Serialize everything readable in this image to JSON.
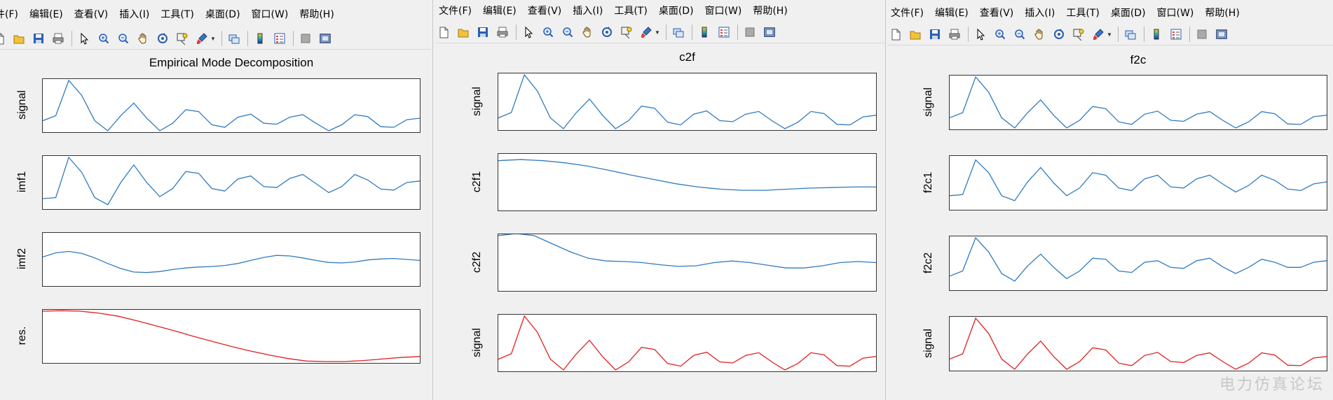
{
  "windows": [
    {
      "id": "left",
      "menu": [
        "件(F)",
        "编辑(E)",
        "查看(V)",
        "插入(I)",
        "工具(T)",
        "桌面(D)",
        "窗口(W)",
        "帮助(H)"
      ],
      "title": "Empirical Mode Decomposition",
      "subplots": [
        {
          "ylabel": "signal",
          "color": "#2f7bbf",
          "values": [
            0.2,
            0.3,
            1.0,
            0.7,
            0.2,
            0.0,
            0.3,
            0.55,
            0.25,
            0.0,
            0.15,
            0.42,
            0.38,
            0.12,
            0.07,
            0.27,
            0.33,
            0.15,
            0.13,
            0.27,
            0.32,
            0.15,
            0.0,
            0.12,
            0.32,
            0.28,
            0.08,
            0.07,
            0.22,
            0.25
          ]
        },
        {
          "ylabel": "imf1",
          "color": "#2f7bbf",
          "values": [
            0.18,
            0.2,
            1.0,
            0.7,
            0.2,
            0.06,
            0.5,
            0.85,
            0.5,
            0.22,
            0.38,
            0.72,
            0.68,
            0.38,
            0.33,
            0.57,
            0.63,
            0.42,
            0.4,
            0.58,
            0.66,
            0.48,
            0.3,
            0.42,
            0.66,
            0.55,
            0.37,
            0.35,
            0.5,
            0.53
          ]
        },
        {
          "ylabel": "imf2",
          "color": "#2f7bbf",
          "values": [
            0.55,
            0.63,
            0.66,
            0.62,
            0.53,
            0.42,
            0.32,
            0.25,
            0.24,
            0.26,
            0.3,
            0.33,
            0.35,
            0.36,
            0.38,
            0.42,
            0.48,
            0.54,
            0.58,
            0.57,
            0.53,
            0.48,
            0.44,
            0.43,
            0.45,
            0.49,
            0.51,
            0.52,
            0.5,
            0.48
          ]
        },
        {
          "ylabel": "res.",
          "color": "#e02020",
          "values": [
            1.0,
            1.01,
            1.0,
            0.96,
            0.9,
            0.81,
            0.71,
            0.61,
            0.5,
            0.4,
            0.3,
            0.21,
            0.13,
            0.06,
            0.01,
            0.0,
            0.0,
            0.02,
            0.05,
            0.08,
            0.1
          ]
        }
      ]
    },
    {
      "id": "mid",
      "menu": [
        "文件(F)",
        "编辑(E)",
        "查看(V)",
        "插入(I)",
        "工具(T)",
        "桌面(D)",
        "窗口(W)",
        "帮助(H)"
      ],
      "title": "c2f",
      "subplots": [
        {
          "ylabel": "signal",
          "color": "#2f7bbf",
          "values": [
            0.2,
            0.3,
            1.0,
            0.7,
            0.2,
            0.0,
            0.3,
            0.55,
            0.25,
            0.0,
            0.15,
            0.42,
            0.38,
            0.12,
            0.07,
            0.27,
            0.33,
            0.15,
            0.13,
            0.27,
            0.32,
            0.15,
            0.0,
            0.12,
            0.32,
            0.28,
            0.08,
            0.07,
            0.22,
            0.25
          ]
        },
        {
          "ylabel": "c2f1",
          "color": "#2f7bbf",
          "values": [
            0.9,
            0.92,
            0.9,
            0.86,
            0.8,
            0.72,
            0.63,
            0.55,
            0.47,
            0.41,
            0.37,
            0.35,
            0.35,
            0.37,
            0.39,
            0.4,
            0.41,
            0.41
          ]
        },
        {
          "ylabel": "c2f2",
          "color": "#2f7bbf",
          "values": [
            1.0,
            1.04,
            1.0,
            0.85,
            0.7,
            0.58,
            0.53,
            0.52,
            0.5,
            0.46,
            0.43,
            0.44,
            0.5,
            0.53,
            0.5,
            0.45,
            0.4,
            0.4,
            0.44,
            0.5,
            0.52,
            0.5
          ]
        },
        {
          "ylabel": "signal",
          "color": "#e02020",
          "values": [
            0.2,
            0.3,
            1.0,
            0.7,
            0.2,
            0.0,
            0.3,
            0.55,
            0.25,
            0.0,
            0.15,
            0.42,
            0.38,
            0.12,
            0.07,
            0.27,
            0.33,
            0.15,
            0.13,
            0.27,
            0.32,
            0.15,
            0.0,
            0.12,
            0.32,
            0.28,
            0.08,
            0.07,
            0.22,
            0.25
          ]
        }
      ]
    },
    {
      "id": "right",
      "menu": [
        "文件(F)",
        "编辑(E)",
        "查看(V)",
        "插入(I)",
        "工具(T)",
        "桌面(D)",
        "窗口(W)",
        "帮助(H)"
      ],
      "title": "f2c",
      "subplots": [
        {
          "ylabel": "signal",
          "color": "#2f7bbf",
          "values": [
            0.2,
            0.3,
            1.0,
            0.7,
            0.2,
            0.0,
            0.3,
            0.55,
            0.25,
            0.0,
            0.15,
            0.42,
            0.38,
            0.12,
            0.07,
            0.27,
            0.33,
            0.15,
            0.13,
            0.27,
            0.32,
            0.15,
            0.0,
            0.12,
            0.32,
            0.28,
            0.08,
            0.07,
            0.22,
            0.25
          ]
        },
        {
          "ylabel": "f2c1",
          "color": "#2f7bbf",
          "values": [
            0.25,
            0.27,
            0.95,
            0.7,
            0.25,
            0.15,
            0.52,
            0.8,
            0.5,
            0.25,
            0.4,
            0.7,
            0.65,
            0.4,
            0.35,
            0.58,
            0.65,
            0.42,
            0.4,
            0.58,
            0.65,
            0.48,
            0.32,
            0.45,
            0.65,
            0.55,
            0.38,
            0.35,
            0.48,
            0.52
          ]
        },
        {
          "ylabel": "f2c2",
          "color": "#2f7bbf",
          "values": [
            0.25,
            0.35,
            1.0,
            0.72,
            0.3,
            0.15,
            0.45,
            0.68,
            0.42,
            0.2,
            0.35,
            0.6,
            0.58,
            0.35,
            0.32,
            0.52,
            0.55,
            0.42,
            0.4,
            0.55,
            0.6,
            0.43,
            0.3,
            0.42,
            0.58,
            0.52,
            0.42,
            0.42,
            0.52,
            0.55
          ]
        },
        {
          "ylabel": "signal",
          "color": "#e02020",
          "values": [
            0.2,
            0.3,
            1.0,
            0.7,
            0.2,
            0.0,
            0.3,
            0.55,
            0.25,
            0.0,
            0.15,
            0.42,
            0.38,
            0.12,
            0.07,
            0.27,
            0.33,
            0.15,
            0.13,
            0.27,
            0.32,
            0.15,
            0.0,
            0.12,
            0.32,
            0.28,
            0.08,
            0.07,
            0.22,
            0.25
          ]
        }
      ]
    }
  ],
  "toolbar_icons": [
    "new-file-icon",
    "open-folder-icon",
    "save-icon",
    "print-icon",
    "|",
    "pointer-icon",
    "zoom-in-icon",
    "zoom-out-icon",
    "pan-hand-icon",
    "rotate-3d-icon",
    "data-cursor-icon",
    "brush-icon",
    "v",
    "|",
    "link-plot-icon",
    "|",
    "colorbar-icon",
    "legend-icon",
    "|",
    "hide-plot-tools-icon",
    "show-plot-tools-icon"
  ],
  "watermark": "电力仿真论坛"
}
